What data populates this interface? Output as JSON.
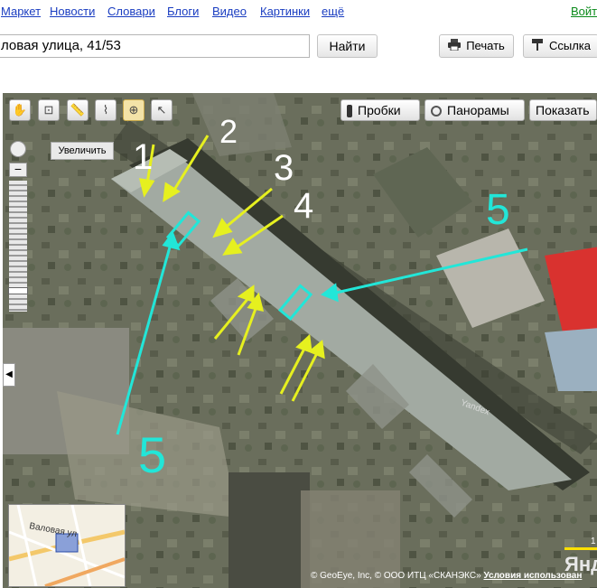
{
  "nav": {
    "links": [
      "Маркет",
      "Новости",
      "Словари",
      "Блоги",
      "Видео",
      "Картинки",
      "ещё"
    ],
    "login": "Войт"
  },
  "search": {
    "value": "ловая улица, 41/53",
    "button": "Найти"
  },
  "actions": {
    "print": "Печать",
    "link": "Ссылка"
  },
  "map": {
    "buttons": {
      "traffic": "Пробки",
      "panoramas": "Панорамы",
      "show": "Показать"
    },
    "tooltip": "Увеличить",
    "annotations": [
      "1",
      "2",
      "3",
      "4",
      "5",
      "5"
    ],
    "annotation_colors": {
      "yellow": "#e6f01f",
      "cyan": "#22e6d8"
    },
    "minimap_street": "Валовая ул",
    "watermark": "Yandex",
    "logo": "Янде",
    "scale": "1",
    "copyright": "© GeoEye, Inc, © ООО ИТЦ «СКАНЭКС»",
    "terms": "Условия использован"
  }
}
